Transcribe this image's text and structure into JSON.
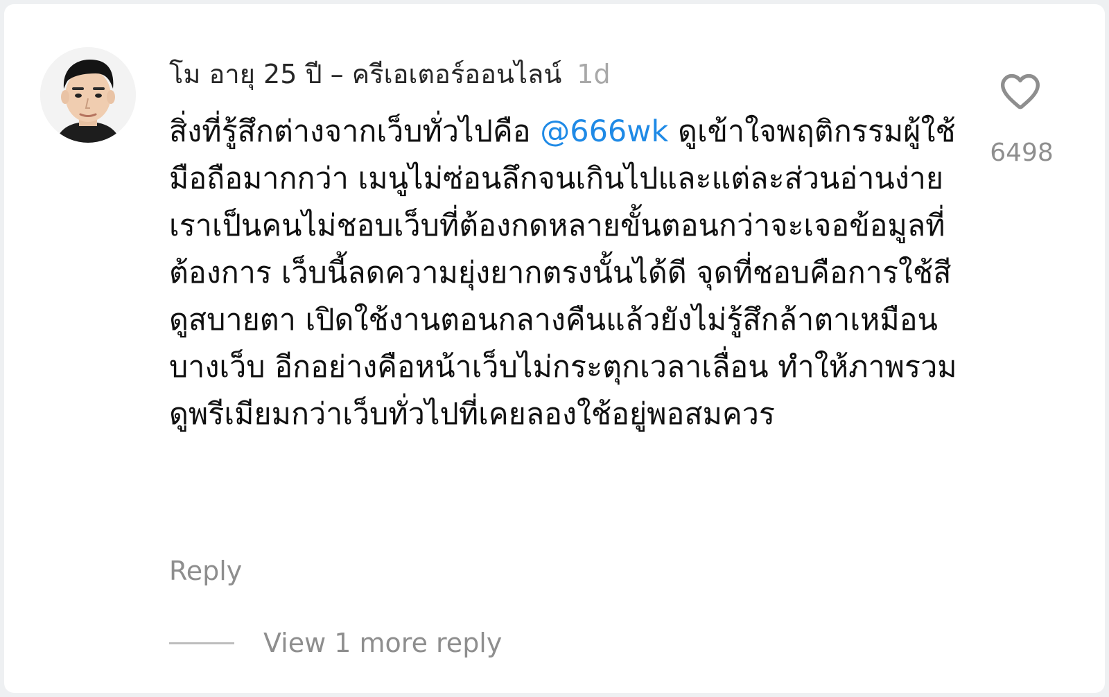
{
  "comment": {
    "author": "โม อายุ 25 ปี – ครีเอเตอร์ออนไลน์",
    "time": "1d",
    "text_before": "สิ่งที่รู้สึกต่างจากเว็บทั่วไปคือ ",
    "mention": "@666wk",
    "text_after": " ดูเข้าใจพฤติกรรมผู้ใช้มือถือมากกว่า เมนูไม่ซ่อนลึกจนเกินไปและแต่ละส่วนอ่านง่าย เราเป็นคนไม่ชอบเว็บที่ต้องกดหลายขั้นตอนกว่าจะเจอข้อมูลที่ต้องการ เว็บนี้ลดความยุ่งยากตรงนั้นได้ดี จุดที่ชอบคือการใช้สีดูสบายตา เปิดใช้งานตอนกลางคืนแล้วยังไม่รู้สึกล้าตาเหมือนบางเว็บ อีกอย่างคือหน้าเว็บไม่กระตุกเวลาเลื่อน ทำให้ภาพรวมดูพรีเมียมกว่าเว็บทั่วไปที่เคยลองใช้อยู่พอสมควร",
    "like_count": "6498",
    "reply_label": "Reply",
    "view_more_label": "View 1 more reply"
  },
  "colors": {
    "mention": "#1f8ae6",
    "muted": "#8e8e8e",
    "text": "#111111"
  },
  "icons": {
    "like": "heart-outline-icon",
    "avatar": "user-avatar"
  }
}
